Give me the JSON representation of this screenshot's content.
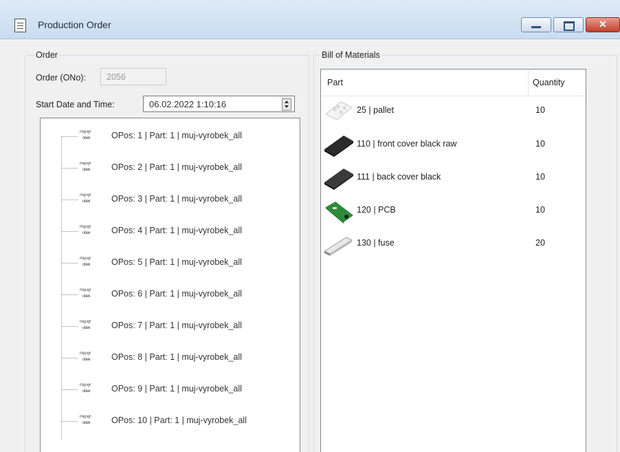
{
  "window": {
    "title": "Production Order"
  },
  "order": {
    "group_label": "Order",
    "number_label": "Order (ONo):",
    "number_value": "2056",
    "start_label": "Start Date and Time:",
    "start_value": "06.02.2022  1:10:16"
  },
  "positions": [
    {
      "label": "OPos: 1 | Part: 1 | muj-vyrobek_all"
    },
    {
      "label": "OPos: 2 | Part: 1 | muj-vyrobek_all"
    },
    {
      "label": "OPos: 3 | Part: 1 | muj-vyrobek_all"
    },
    {
      "label": "OPos: 4 | Part: 1 | muj-vyrobek_all"
    },
    {
      "label": "OPos: 5 | Part: 1 | muj-vyrobek_all"
    },
    {
      "label": "OPos: 6 | Part: 1 | muj-vyrobek_all"
    },
    {
      "label": "OPos: 7 | Part: 1 | muj-vyrobek_all"
    },
    {
      "label": "OPos: 8 | Part: 1 | muj-vyrobek_all"
    },
    {
      "label": "OPos: 9 | Part: 1 | muj-vyrobek_all"
    },
    {
      "label": "OPos: 10 | Part: 1 | muj-vyrobek_all"
    }
  ],
  "op_icon": {
    "line1": "muj výr",
    "line2": "obek"
  },
  "bom": {
    "group_label": "Bill of Materials",
    "col_part": "Part",
    "col_quantity": "Quantity",
    "rows": [
      {
        "part": "25 | pallet",
        "quantity": "10",
        "icon": "pallet-icon"
      },
      {
        "part": "110 | front cover black raw",
        "quantity": "10",
        "icon": "front-cover-icon"
      },
      {
        "part": "111 | back cover black",
        "quantity": "10",
        "icon": "back-cover-icon"
      },
      {
        "part": "120 | PCB",
        "quantity": "10",
        "icon": "pcb-icon"
      },
      {
        "part": "130 | fuse",
        "quantity": "20",
        "icon": "fuse-icon"
      }
    ]
  },
  "colors": {
    "pcb_green": "#2e8b3a",
    "cover_black": "#2b2b2b",
    "close_red": "#c2402c"
  }
}
